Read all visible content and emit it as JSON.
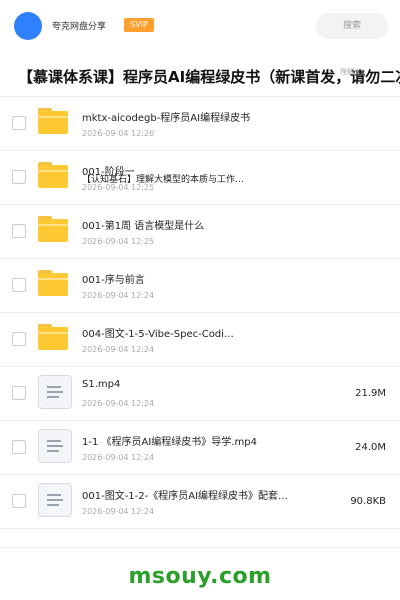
{
  "header": {
    "share_name": "夸克网盘分享",
    "badge": "SVIP",
    "search_label": "搜索"
  },
  "title": {
    "text": "【慕课体系课】程序员AI编程绿皮书（新课首发，请勿二次",
    "overlay": "理解大"
  },
  "items": [
    {
      "name": "mktx-aicodegb-程序员AI编程绿皮书",
      "date": "2026-09-04 12:26",
      "size": "",
      "type": "folder"
    },
    {
      "name": "001-阶段一",
      "date": "2026-09-04 12:25",
      "overlay": "【认知基石】理解大模型的本质与工作…",
      "size": "",
      "type": "folder"
    },
    {
      "name": "001-第1周 语言模型是什么",
      "date": "2026-09-04 12:25",
      "size": "",
      "type": "folder"
    },
    {
      "name": "001-序与前言",
      "date": "2026-09-04 12:24",
      "size": "",
      "type": "folder"
    },
    {
      "name": "004-图文-1-5-Vibe-Spec-Codi…",
      "date": "2026-09-04 12:24",
      "size": "",
      "type": "folder"
    },
    {
      "name": "S1.mp4",
      "date": "2026-09-04 12:24",
      "size": "21.9M",
      "type": "file"
    },
    {
      "name": "1-1 《程序员AI编程绿皮书》导学.mp4",
      "date": "2026-09-04 12:24",
      "size": "24.0M",
      "type": "file"
    },
    {
      "name": "001-图文-1-2-《程序员AI编程绿皮书》配套…",
      "date": "2026-09-04 12:24",
      "size": "90.8KB",
      "type": "file"
    }
  ],
  "watermark": "msouy.com",
  "colors": {
    "accent": "#2f80ff",
    "badge": "#ff9f2d",
    "folder": "#ffc933",
    "watermark": "#2aa02a"
  }
}
